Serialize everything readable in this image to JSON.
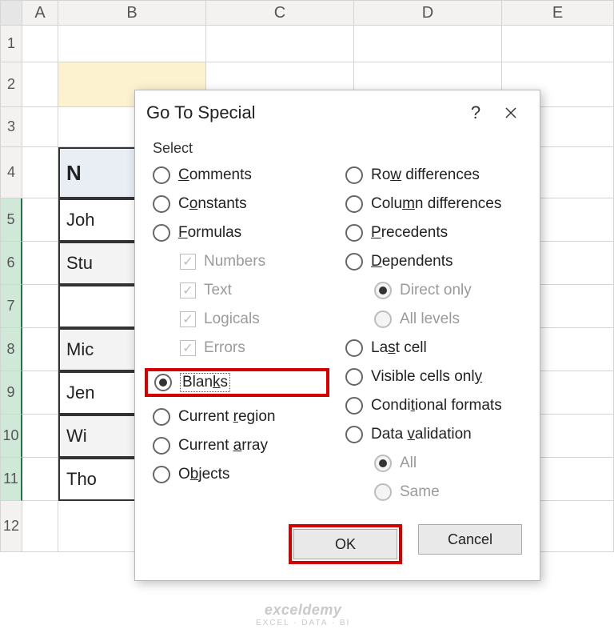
{
  "columns": [
    "A",
    "B",
    "C",
    "D",
    "E"
  ],
  "rows": [
    "1",
    "2",
    "3",
    "4",
    "5",
    "6",
    "7",
    "8",
    "9",
    "10",
    "11",
    "12"
  ],
  "selected_rows": [
    "5",
    "6",
    "7",
    "8",
    "9",
    "10",
    "11"
  ],
  "table": {
    "header_col_b": "N",
    "values_col_b": [
      "Joh",
      "Stu",
      "",
      "Mic",
      "Jen",
      "Wi",
      "Tho"
    ]
  },
  "dialog": {
    "title": "Go To Special",
    "group_label": "Select",
    "options_left": [
      {
        "label": "Comments",
        "u": "C"
      },
      {
        "label": "Constants",
        "u": "o"
      },
      {
        "label": "Formulas",
        "u": "F"
      },
      {
        "label": "Blanks",
        "u": "k",
        "selected": true,
        "focus": true,
        "highlighted": true
      },
      {
        "label": "Current region",
        "u": "r"
      },
      {
        "label": "Current array",
        "u": "a"
      },
      {
        "label": "Objects",
        "u": "b"
      }
    ],
    "formula_subs": [
      "Numbers",
      "Text",
      "Logicals",
      "Errors"
    ],
    "options_right": [
      {
        "label": "Row differences",
        "u": "w"
      },
      {
        "label": "Column differences",
        "u": "m"
      },
      {
        "label": "Precedents",
        "u": "P"
      },
      {
        "label": "Dependents",
        "u": "D"
      },
      {
        "label": "Last cell",
        "u": "s"
      },
      {
        "label": "Visible cells only",
        "u": "y"
      },
      {
        "label": "Conditional formats",
        "u": "t"
      },
      {
        "label": "Data validation",
        "u": "v"
      }
    ],
    "dependent_subs": [
      "Direct only",
      "All levels"
    ],
    "validation_subs": [
      "All",
      "Same"
    ],
    "ok_label": "OK",
    "cancel_label": "Cancel"
  },
  "watermark": {
    "main": "exceldemy",
    "sub": "EXCEL · DATA · BI"
  }
}
